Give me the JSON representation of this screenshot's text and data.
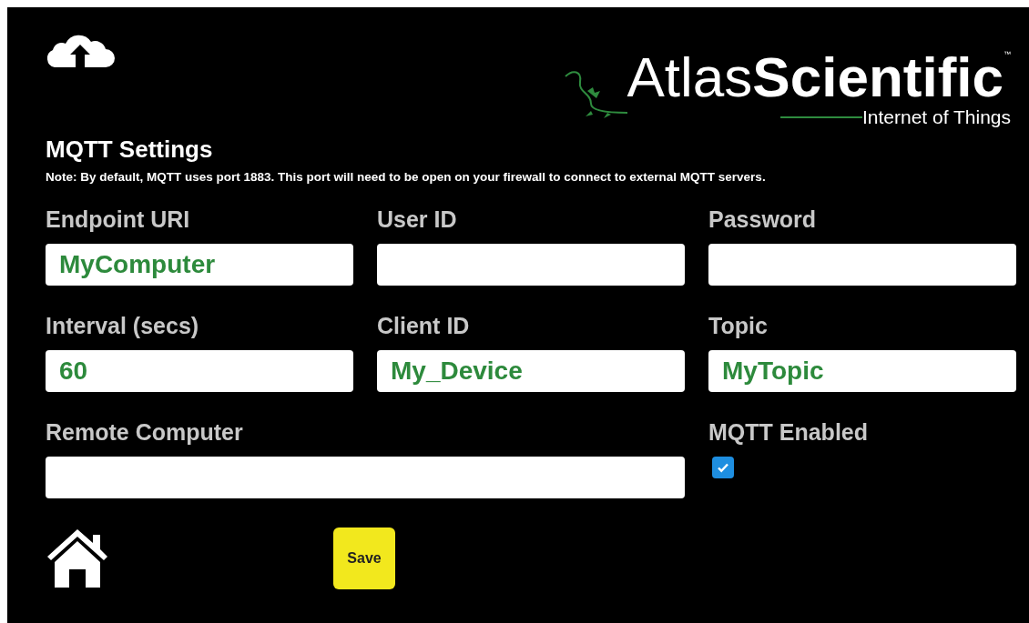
{
  "logo": {
    "light": "Atlas",
    "bold": "Scientific",
    "trademark": "™",
    "tagline": "Internet of Things"
  },
  "title": "MQTT Settings",
  "note": "Note: By default, MQTT uses port 1883. This port will need to be open on your firewall to connect to external MQTT servers.",
  "fields": [
    {
      "kind": "text",
      "label": "Endpoint URI",
      "value": "MyComputer"
    },
    {
      "kind": "text",
      "label": "User ID"
    },
    {
      "kind": "text",
      "label": "Password"
    },
    {
      "kind": "text",
      "label": "Interval (secs)",
      "value": "60"
    },
    {
      "kind": "text",
      "label": "Client ID",
      "value": "My_Device"
    },
    {
      "kind": "text",
      "label": "Topic",
      "value": "MyTopic"
    },
    {
      "kind": "wide",
      "label": "Remote Computer"
    },
    {
      "kind": "checkbox",
      "label": "MQTT Enabled",
      "checked": true
    }
  ],
  "save_button": "Save"
}
